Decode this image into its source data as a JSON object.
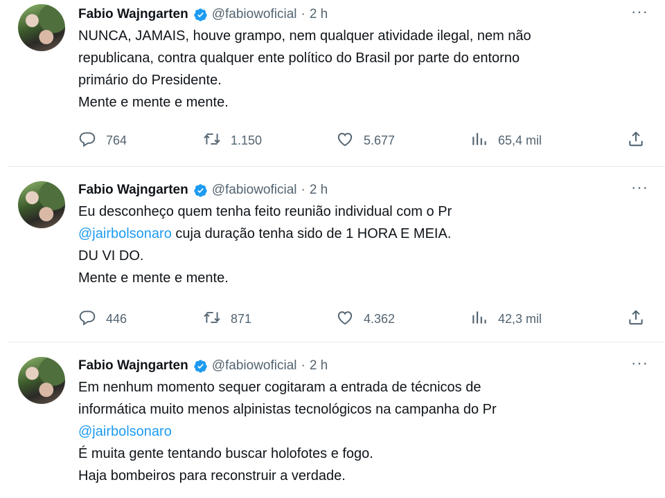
{
  "tweets": [
    {
      "author": {
        "name": "Fabio Wajngarten",
        "handle": "@fabiowoficial",
        "time": "2 h",
        "separator": "·"
      },
      "lines": [
        [
          {
            "text": "NUNCA, JAMAIS, houve grampo, nem qualquer atividade ilegal, nem não"
          }
        ],
        [
          {
            "text": "republicana, contra qualquer ente político do Brasil por parte do entorno"
          }
        ],
        [
          {
            "text": "primário do Presidente."
          }
        ],
        [
          {
            "text": "Mente e mente e mente."
          }
        ]
      ],
      "stats": {
        "replies": "764",
        "retweets": "1.150",
        "likes": "5.677",
        "views": "65,4 mil"
      }
    },
    {
      "author": {
        "name": "Fabio Wajngarten",
        "handle": "@fabiowoficial",
        "time": "2 h",
        "separator": "·"
      },
      "lines": [
        [
          {
            "text": "Eu desconheço quem tenha feito reunião individual com o Pr"
          }
        ],
        [
          {
            "text": "@jairbolsonaro",
            "mention": true
          },
          {
            "text": " cuja duração tenha sido de 1 HORA E MEIA."
          }
        ],
        [
          {
            "text": "DU VI DO."
          }
        ],
        [
          {
            "text": "Mente e mente e mente."
          }
        ]
      ],
      "stats": {
        "replies": "446",
        "retweets": "871",
        "likes": "4.362",
        "views": "42,3 mil"
      }
    },
    {
      "author": {
        "name": "Fabio Wajngarten",
        "handle": "@fabiowoficial",
        "time": "2 h",
        "separator": "·"
      },
      "lines": [
        [
          {
            "text": "Em nenhum momento sequer cogitaram a entrada de técnicos de"
          }
        ],
        [
          {
            "text": "informática muito menos alpinistas tecnológicos na campanha do Pr"
          }
        ],
        [
          {
            "text": "@jairbolsonaro",
            "mention": true
          }
        ],
        [
          {
            "text": "É muita gente tentando buscar holofotes e fogo."
          }
        ],
        [
          {
            "text": "Haja bombeiros para reconstruir a verdade."
          }
        ]
      ]
    }
  ],
  "more_label": "···",
  "colors": {
    "text": "#0f1419",
    "muted": "#536471",
    "accent": "#1d9bf0",
    "divider": "#e6ebee"
  },
  "icons": [
    "verified-badge-icon",
    "more-icon",
    "reply-icon",
    "retweet-icon",
    "like-icon",
    "views-icon",
    "share-icon"
  ]
}
